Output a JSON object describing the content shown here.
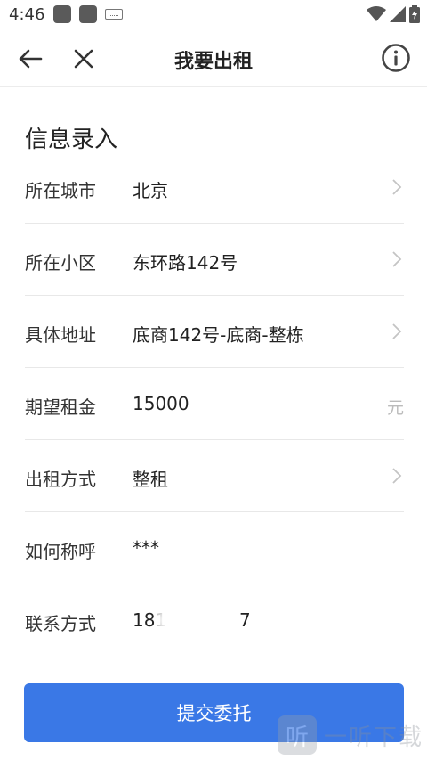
{
  "status_bar": {
    "time": "4:46"
  },
  "nav": {
    "title": "我要出租"
  },
  "section": {
    "title": "信息录入"
  },
  "form": {
    "rows": [
      {
        "label": "所在城市",
        "value": "北京"
      },
      {
        "label": "所在小区",
        "value": "东环路142号"
      },
      {
        "label": "具体地址",
        "value": "底商142号-底商-整栋"
      },
      {
        "label": "期望租金",
        "value": "15000",
        "unit": "元"
      },
      {
        "label": "出租方式",
        "value": "整租"
      },
      {
        "label": "如何称呼",
        "value": "***"
      },
      {
        "label": "联系方式",
        "value_start": "181",
        "value_end": "7"
      }
    ]
  },
  "submit": {
    "label": "提交委托"
  },
  "watermark": {
    "logo_text": "听",
    "text": "一听下载"
  },
  "colors": {
    "primary": "#3a78e6",
    "divider": "#e8e8e8"
  }
}
